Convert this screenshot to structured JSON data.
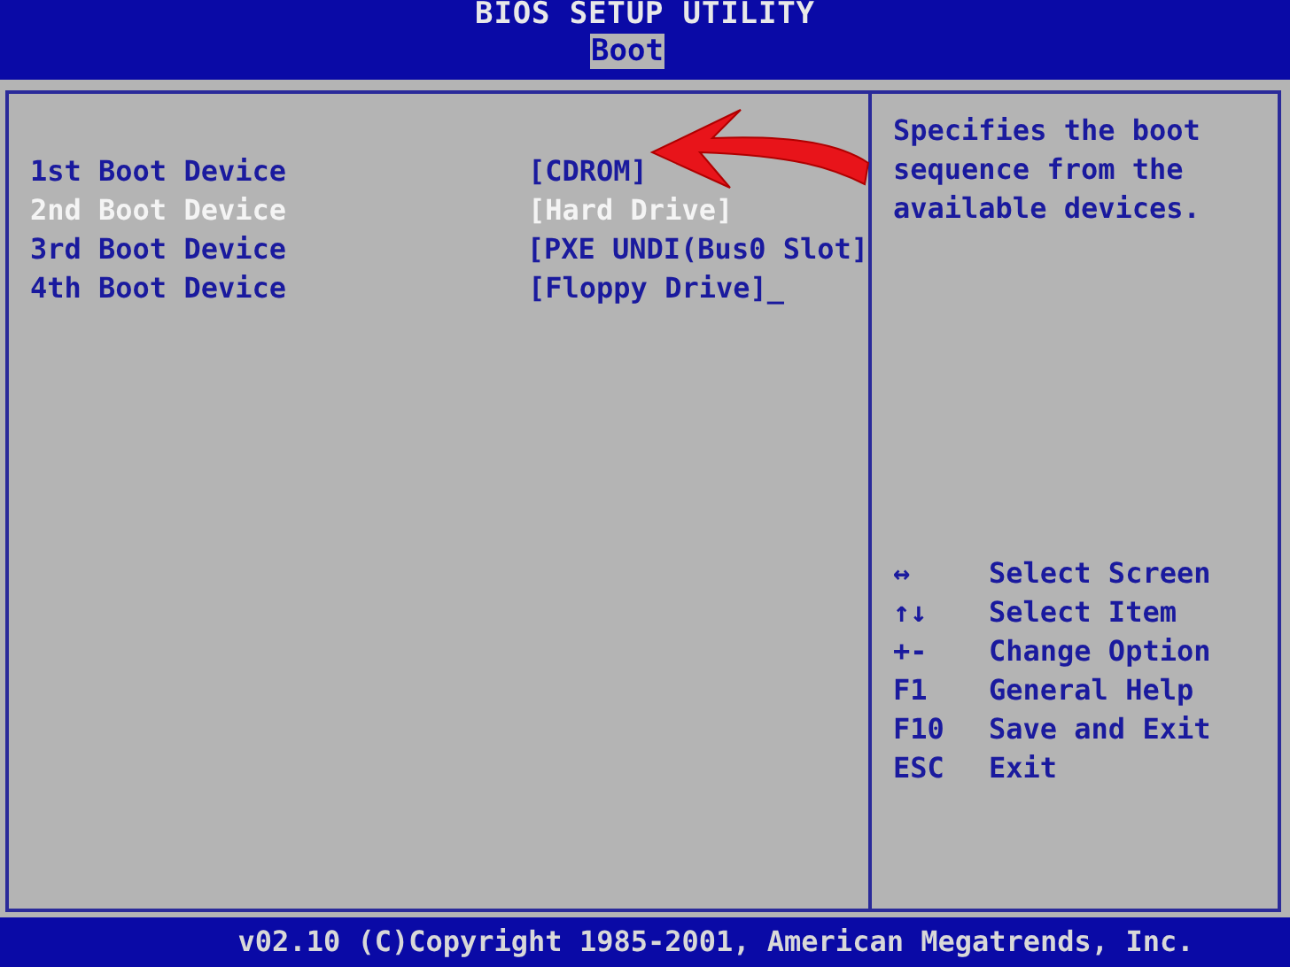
{
  "window": {
    "title": "BIOS SETUP UTILITY"
  },
  "tabs": [
    {
      "label": "Boot",
      "selected": true
    }
  ],
  "boot_devices": [
    {
      "label": "1st Boot Device",
      "value": "[CDROM]",
      "selected": false
    },
    {
      "label": "2nd Boot Device",
      "value": "[Hard Drive]",
      "selected": true
    },
    {
      "label": "3rd Boot Device",
      "value": "[PXE UNDI(Bus0 Slot]",
      "selected": false
    },
    {
      "label": "4th Boot Device",
      "value": "[Floppy Drive]",
      "selected": false
    }
  ],
  "cursor": "_",
  "help_text": "Specifies the boot sequence from the available devices.",
  "key_legend": [
    {
      "key": "↔",
      "action": "Select Screen"
    },
    {
      "key": "↑↓",
      "action": "Select Item"
    },
    {
      "key": "+-",
      "action": "Change Option"
    },
    {
      "key": "F1",
      "action": "General Help"
    },
    {
      "key": "F10",
      "action": "Save and Exit"
    },
    {
      "key": "ESC",
      "action": "Exit"
    }
  ],
  "status_bar": "v02.10 (C)Copyright 1985-2001, American Megatrends, Inc."
}
